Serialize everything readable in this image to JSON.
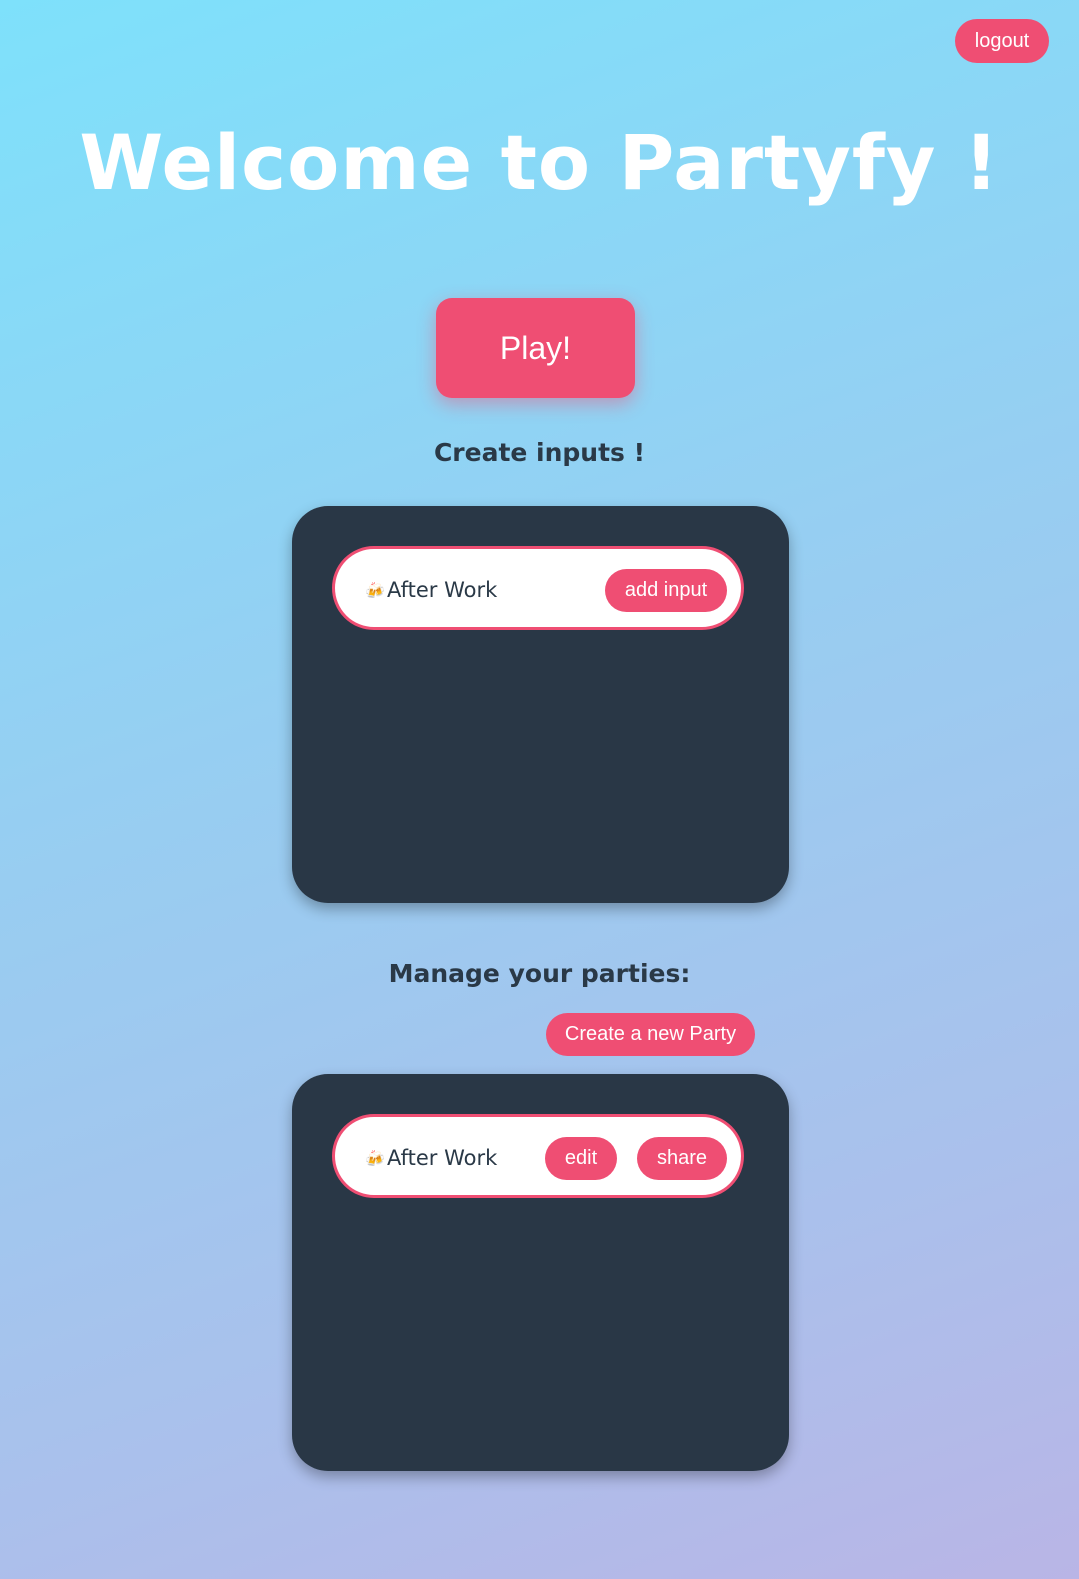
{
  "header": {
    "logout_label": "logout",
    "title": "Welcome to Partyfy !"
  },
  "play": {
    "label": "Play!"
  },
  "create_inputs": {
    "heading": "Create inputs !",
    "items": [
      {
        "emoji": "🍻",
        "name": "After Work",
        "add_label": "add input"
      }
    ]
  },
  "manage_parties": {
    "heading": "Manage your parties:",
    "new_party_label": "Create a new Party",
    "items": [
      {
        "emoji": "🍻",
        "name": "After Work",
        "edit_label": "edit",
        "share_label": "share"
      }
    ]
  },
  "colors": {
    "accent": "#ef4e73",
    "panel": "#293746",
    "heading_text": "#2a3947"
  }
}
